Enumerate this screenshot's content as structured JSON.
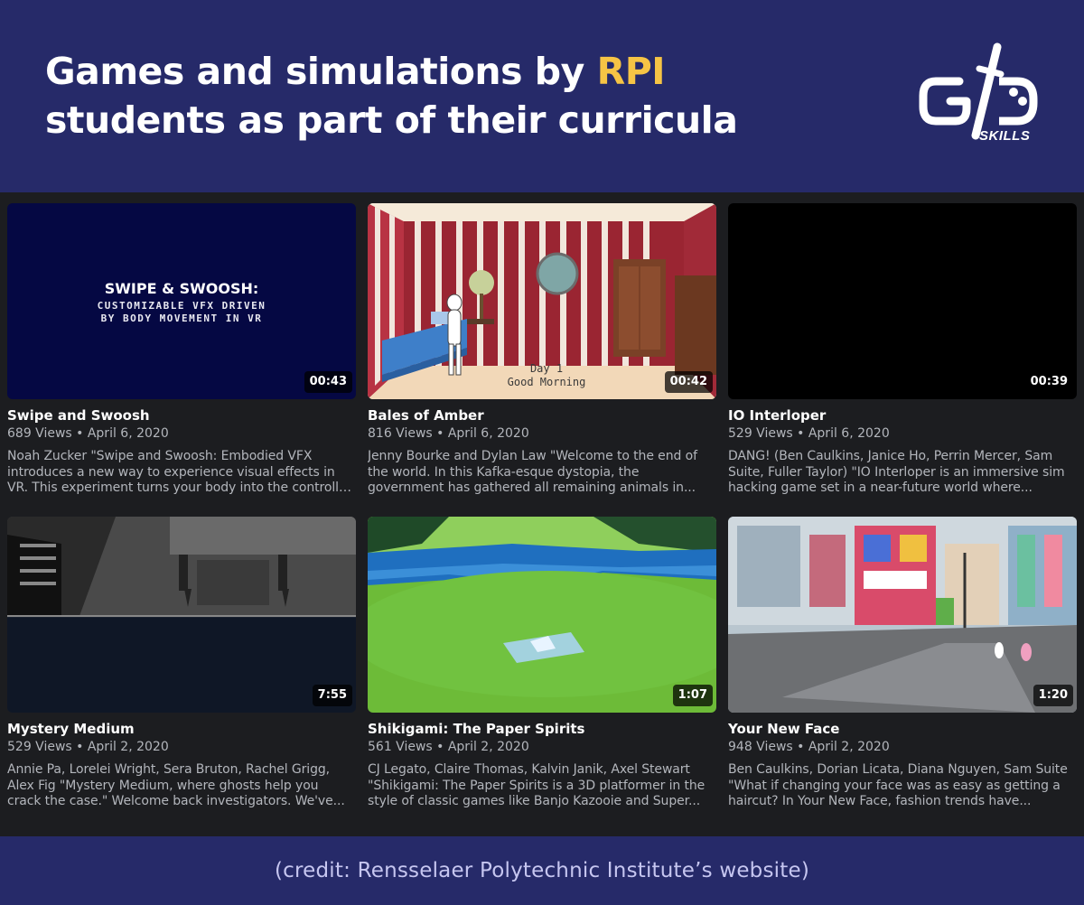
{
  "header": {
    "headline_part1": "Games and simulations by ",
    "headline_accent": "RPI",
    "headline_part2": "students as part of their curricula",
    "accent_color": "#f6c445",
    "background_color": "#262a69",
    "logo": {
      "icon": "gd-skills-logo",
      "text": "SKILLS"
    }
  },
  "videos": [
    {
      "title": "Swipe and Swoosh",
      "meta": "689 Views • April 6, 2020",
      "duration": "00:43",
      "description": "Noah Zucker \"Swipe and Swoosh: Embodied VFX introduces a new way to experience visual effects in VR. This experiment turns your body into the controller by...",
      "thumb_line1": "SWIPE & SWOOSH:",
      "thumb_line2": "CUSTOMIZABLE VFX DRIVEN",
      "thumb_line3": "BY BODY MOVEMENT IN VR"
    },
    {
      "title": "Bales of Amber",
      "meta": "816 Views • April 6, 2020",
      "duration": "00:42",
      "description": "Jenny Bourke and Dylan Law \"Welcome to the end of the world. In this Kafka-esque dystopia, the government has gathered all remaining animals in...",
      "thumb_line1": "Day 1",
      "thumb_line2": "Good Morning"
    },
    {
      "title": "IO Interloper",
      "meta": "529 Views • April 6, 2020",
      "duration": "00:39",
      "description": "DANG! (Ben Caulkins, Janice Ho, Perrin Mercer, Sam Suite, Fuller Taylor) \"IO Interloper is an immersive sim hacking game set in a near-future world where..."
    },
    {
      "title": "Mystery Medium",
      "meta": "529 Views • April 2, 2020",
      "duration": "7:55",
      "description": "Annie Pa, Lorelei Wright, Sera Bruton, Rachel Grigg, Alex Fig \"Mystery Medium, where ghosts help you crack the case.\" Welcome back investigators. We've..."
    },
    {
      "title": "Shikigami: The Paper Spirits",
      "meta": "561 Views • April 2, 2020",
      "duration": "1:07",
      "description": "CJ Legato, Claire Thomas, Kalvin Janik, Axel Stewart \"Shikigami: The Paper Spirits is a 3D platformer in the style of classic games like Banjo Kazooie and Super..."
    },
    {
      "title": "Your New Face",
      "meta": "948 Views • April 2, 2020",
      "duration": "1:20",
      "description": "Ben Caulkins, Dorian Licata, Diana Nguyen, Sam Suite \"What if changing your face was as easy as getting a haircut? In Your New Face, fashion trends have..."
    }
  ],
  "footer": {
    "credit": "(credit: Rensselaer Polytechnic Institute’s website)"
  }
}
